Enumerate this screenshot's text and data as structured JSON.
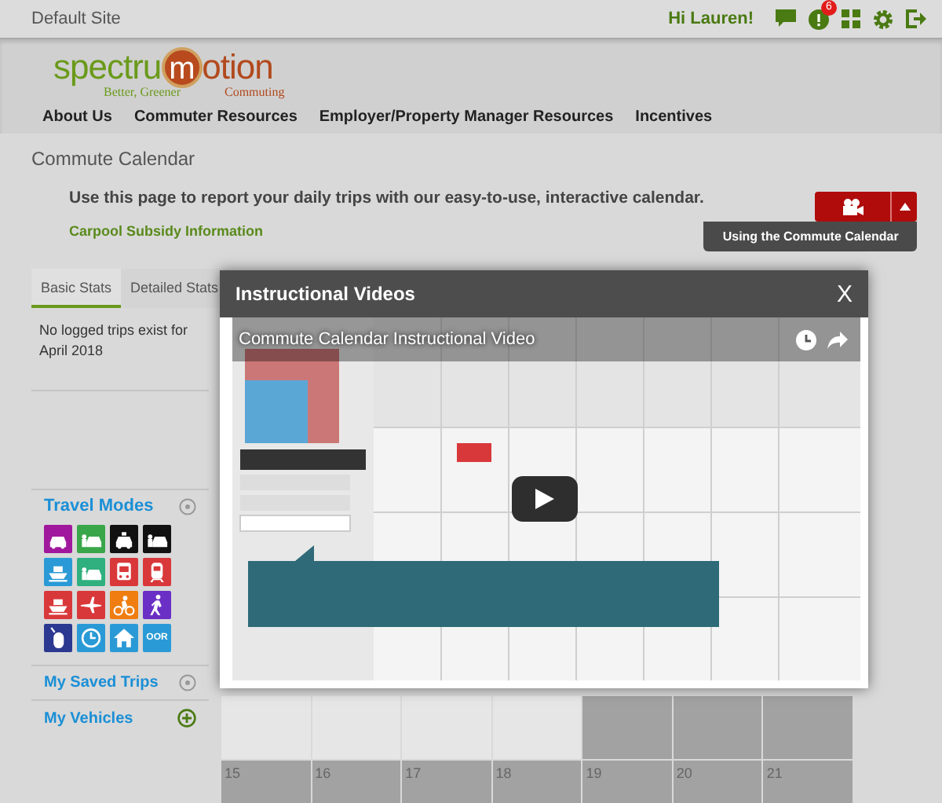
{
  "top_bar": {
    "site": "Default Site",
    "greeting": "Hi Lauren!",
    "icons": [
      {
        "kind": "chat"
      },
      {
        "kind": "alert",
        "badge": "6"
      },
      {
        "kind": "grid"
      },
      {
        "kind": "settings"
      },
      {
        "kind": "logout"
      }
    ]
  },
  "logo": {
    "prefix": "spectru",
    "emblem": "m",
    "suffix": "otion",
    "tagline_left": "Better, Greener",
    "tagline_right": "Commuting"
  },
  "nav": [
    "About Us",
    "Commuter Resources",
    "Employer/Property Manager Resources",
    "Incentives"
  ],
  "page_title": "Commute Calendar",
  "intro": {
    "message": "Use this page to report your daily trips with our easy-to-use, interactive calendar.",
    "link": "Carpool Subsidy Information"
  },
  "video_menu": {
    "expanded": true,
    "items": [
      "Using the Commute Calendar"
    ]
  },
  "tabs": [
    {
      "label": "Basic Stats",
      "selected": true
    },
    {
      "label": "Detailed Stats",
      "selected": false
    }
  ],
  "stats_text": "No logged trips exist for April 2018",
  "travel_modes": {
    "title": "Travel Modes",
    "modes": [
      {
        "kind": "car",
        "color": "#a0189c"
      },
      {
        "kind": "carpool",
        "color": "#3aa64a"
      },
      {
        "kind": "taxi",
        "color": "#111111"
      },
      {
        "kind": "carpool",
        "color": "#111111"
      },
      {
        "kind": "ferry",
        "color": "#2a9ad6"
      },
      {
        "kind": "vanpool",
        "color": "#2fb07e"
      },
      {
        "kind": "bus",
        "color": "#d9383a"
      },
      {
        "kind": "train",
        "color": "#d9383a"
      },
      {
        "kind": "ferry",
        "color": "#d9383a"
      },
      {
        "kind": "plane",
        "color": "#d9383a"
      },
      {
        "kind": "bike",
        "color": "#ef7d10"
      },
      {
        "kind": "walk",
        "color": "#6a2fc4"
      },
      {
        "kind": "mouse",
        "color": "#2b3990"
      },
      {
        "kind": "clock",
        "color": "#2a9ad6"
      },
      {
        "kind": "home",
        "color": "#2a9ad6"
      },
      {
        "kind": "text",
        "label": "OOR",
        "color": "#2a9ad6"
      }
    ]
  },
  "sections": [
    {
      "title": "My Saved Trips",
      "kind": "help"
    },
    {
      "title": "My Vehicles",
      "kind": "add"
    }
  ],
  "calendar": {
    "weeks": [
      {
        "days": [
          {
            "shaded": false
          },
          {
            "shaded": false
          },
          {
            "shaded": false
          },
          {
            "shaded": false
          },
          {
            "shaded": true
          },
          {
            "shaded": true
          },
          {
            "shaded": true
          }
        ]
      },
      {
        "days": [
          {
            "label": "15",
            "shaded": true
          },
          {
            "label": "16",
            "shaded": true
          },
          {
            "label": "17",
            "shaded": true
          },
          {
            "label": "18",
            "shaded": true
          },
          {
            "label": "19",
            "shaded": true
          },
          {
            "label": "20",
            "shaded": true
          },
          {
            "label": "21",
            "shaded": true
          }
        ]
      }
    ]
  },
  "modal": {
    "title": "Instructional Videos",
    "close": "X",
    "video": {
      "kind": "picture",
      "title": "Commute Calendar Instructional Video"
    }
  }
}
